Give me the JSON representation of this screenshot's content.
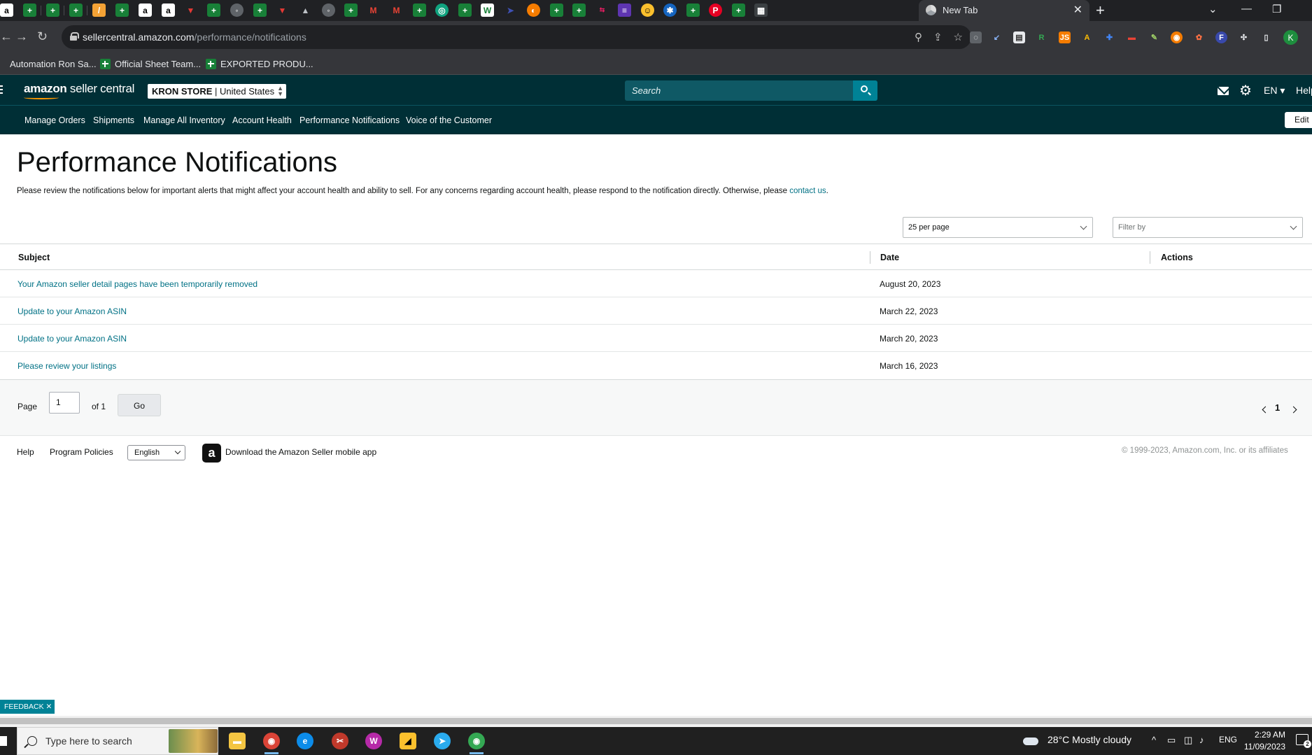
{
  "browser": {
    "active_tab_title": "New Tab",
    "url_host": "sellercentral.amazon.com",
    "url_path": "/performance/notifications",
    "profile_initial": "K",
    "bookmarks": [
      "Automation Ron Sa...",
      "Official Sheet Team...",
      "EXPORTED PRODU..."
    ]
  },
  "header": {
    "logo_bold": "amazon",
    "logo_rest": " seller central",
    "store_name": "KRON STORE",
    "store_region": " | United States",
    "search_placeholder": "Search",
    "language": "EN",
    "help_label": "Help",
    "edit_label": "Edit"
  },
  "nav": {
    "items": [
      "Manage Orders",
      "Shipments",
      "Manage All Inventory",
      "Account Health",
      "Performance Notifications",
      "Voice of the Customer"
    ]
  },
  "page": {
    "title": "Performance Notifications",
    "intro_text": "Please review the notifications below for important alerts that might affect your account health and ability to sell. For any concerns regarding account health, please respond to the notification directly. Otherwise, please ",
    "intro_link": "contact us",
    "intro_end": ".",
    "per_page": "25 per page",
    "filter_placeholder": "Filter by"
  },
  "table": {
    "headers": {
      "subject": "Subject",
      "date": "Date",
      "actions": "Actions"
    },
    "rows": [
      {
        "subject": "Your Amazon seller detail pages have been temporarily removed",
        "date": "August 20, 2023"
      },
      {
        "subject": "Update to your Amazon ASIN",
        "date": "March 22, 2023"
      },
      {
        "subject": "Update to your Amazon ASIN",
        "date": "March 20, 2023"
      },
      {
        "subject": "Please review your listings",
        "date": "March 16, 2023"
      }
    ]
  },
  "pagination": {
    "page_label": "Page",
    "page_value": "1",
    "of_label": "of 1",
    "go_label": "Go",
    "current_page": "1"
  },
  "footer": {
    "help": "Help",
    "program_policies": "Program Policies",
    "language": "English",
    "app_icon": "a",
    "download_app": "Download the Amazon Seller mobile app",
    "copyright": "© 1999-2023, Amazon.com, Inc. or its affiliates"
  },
  "feedback_label": "FEEDBACK ✕",
  "taskbar": {
    "search_placeholder": "Type here to search",
    "weather": "28°C  Mostly cloudy",
    "language": "ENG",
    "time": "2:29 AM",
    "date": "11/09/2023",
    "notification_count": "2"
  },
  "colors": {
    "header_bg": "#002f36",
    "link": "#007185",
    "search_button": "#008296"
  }
}
